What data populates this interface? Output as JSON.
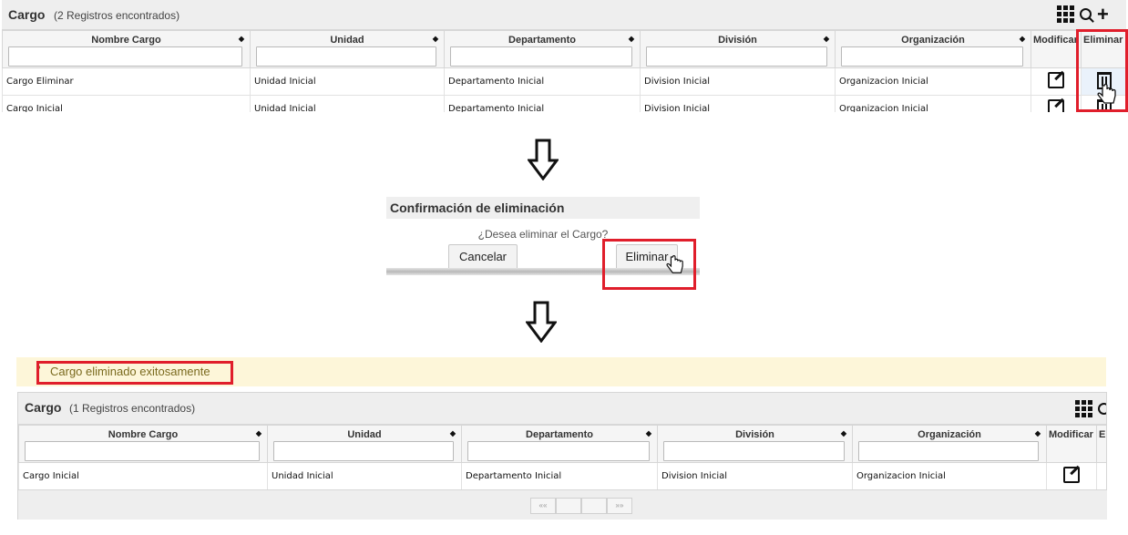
{
  "panel1": {
    "title": "Cargo",
    "count": "(2 Registros encontrados)",
    "columns": [
      "Nombre Cargo",
      "Unidad",
      "Departamento",
      "División",
      "Organización",
      "Modificar",
      "Eliminar"
    ],
    "rows": [
      [
        "Cargo Eliminar",
        "Unidad Inicial",
        "Departamento Inicial",
        "Division Inicial",
        "Organizacion Inicial"
      ],
      [
        "Cargo Inicial",
        "Unidad Inicial",
        "Departamento Inicial",
        "Division Inicial",
        "Organizacion Inicial"
      ]
    ]
  },
  "dialog": {
    "title": "Confirmación de eliminación",
    "message": "¿Desea eliminar el Cargo?",
    "cancel_label": "Cancelar",
    "delete_label": "Eliminar"
  },
  "message": {
    "text": "Cargo eliminado exitosamente"
  },
  "panel2": {
    "title": "Cargo",
    "count": "(1 Registros encontrados)",
    "columns": [
      "Nombre Cargo",
      "Unidad",
      "Departamento",
      "División",
      "Organización",
      "Modificar",
      "E"
    ],
    "rows": [
      [
        "Cargo Inicial",
        "Unidad Inicial",
        "Departamento Inicial",
        "Division Inicial",
        "Organizacion Inicial"
      ]
    ]
  },
  "pager": {
    "first": "«",
    "prev": "«",
    "next": "»",
    "last": "»"
  },
  "colors": {
    "highlight": "#e01e2b",
    "message_bg": "#fdf6d9",
    "message_text": "#7a6a1e"
  },
  "icons": [
    "grid-menu-icon",
    "search-icon",
    "add-icon",
    "edit-icon",
    "trash-icon",
    "hand-cursor-icon",
    "down-arrow-icon",
    "sort-icon"
  ]
}
